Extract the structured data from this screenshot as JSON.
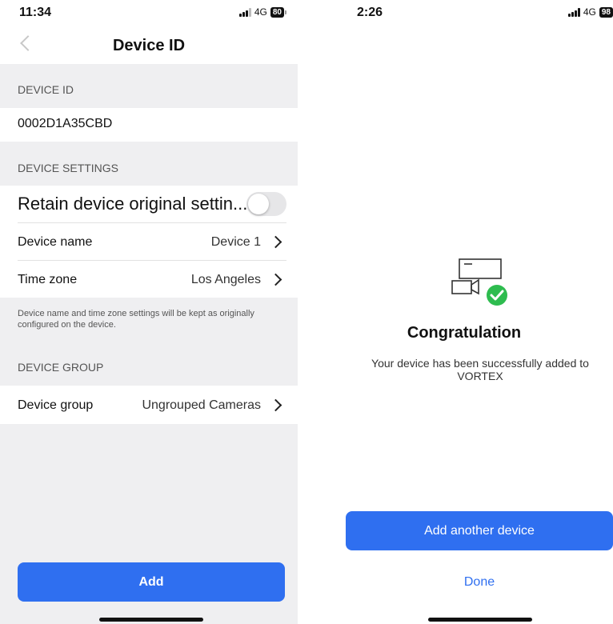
{
  "left_screen": {
    "status": {
      "time": "11:34",
      "network": "4G",
      "battery": "80"
    },
    "nav": {
      "title": "Device ID"
    },
    "device_id_section": {
      "header": "DEVICE ID",
      "value": "0002D1A35CBD"
    },
    "settings_section": {
      "header": "DEVICE SETTINGS",
      "retain_label": "Retain device original settin...",
      "retain_toggle_on": false,
      "device_name_label": "Device name",
      "device_name_value": "Device 1",
      "time_zone_label": "Time zone",
      "time_zone_value": "Los Angeles",
      "note": "Device name and time zone settings will be kept as originally configured on the device."
    },
    "group_section": {
      "header": "DEVICE GROUP",
      "group_label": "Device group",
      "group_value": "Ungrouped Cameras"
    },
    "add_button": "Add"
  },
  "right_screen": {
    "status": {
      "time": "2:26",
      "network": "4G",
      "battery": "98"
    },
    "success_icon_name": "camera-check-icon",
    "title": "Congratulation",
    "message": "Your device has been successfully added to VORTEX",
    "add_another_button": "Add another device",
    "done_link": "Done"
  },
  "colors": {
    "accent": "#2f6ff0",
    "success": "#2ebc4f",
    "section_bg": "#efeff1"
  }
}
